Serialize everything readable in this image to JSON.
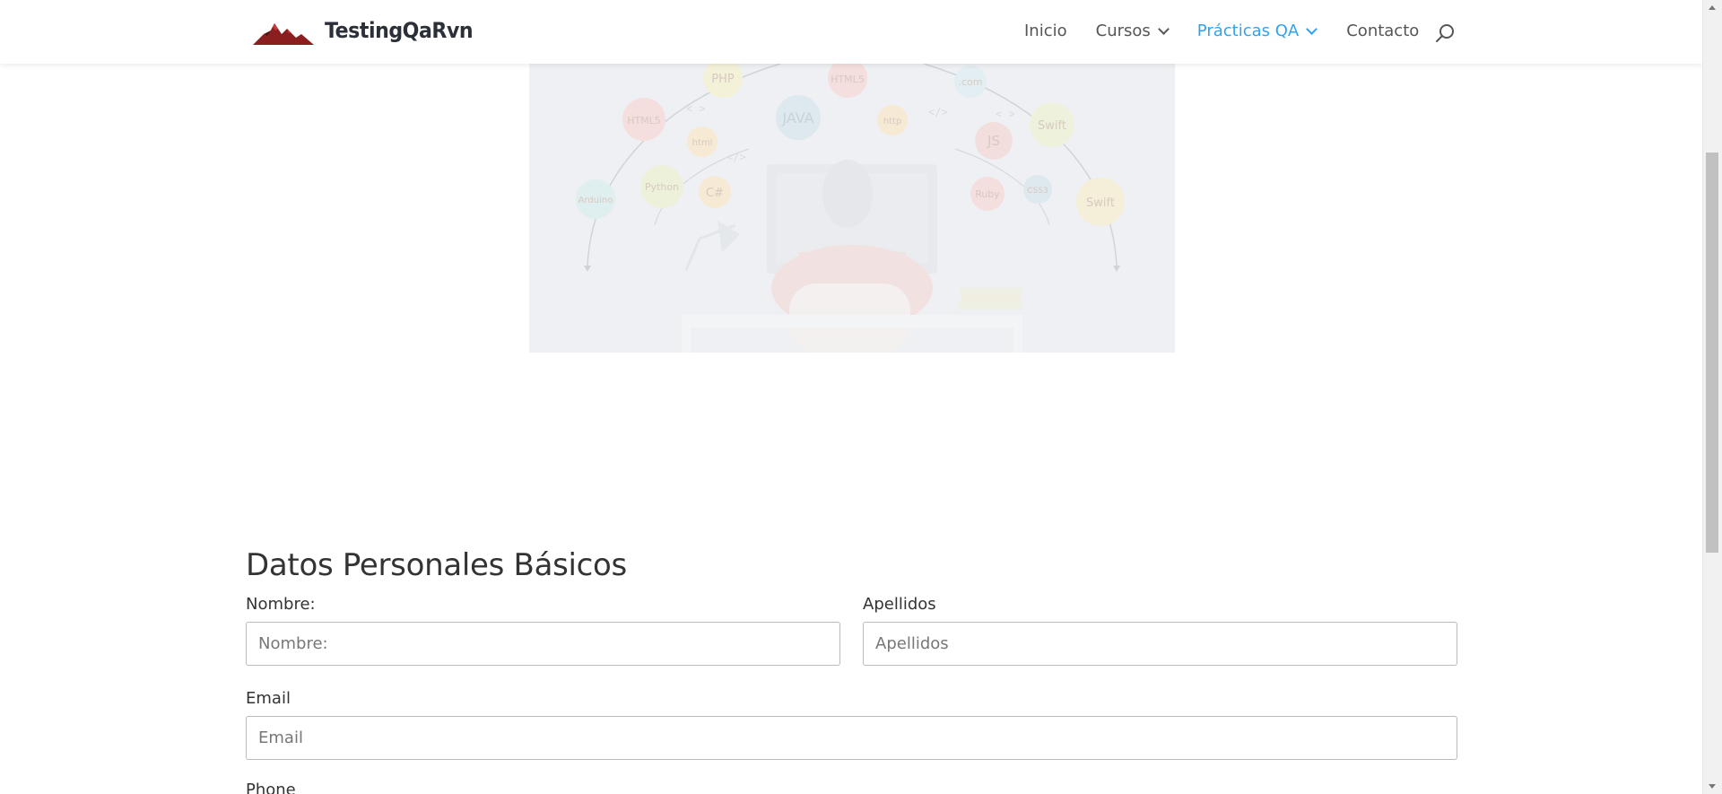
{
  "header": {
    "logo_text": "TestingQaRvn",
    "nav": [
      {
        "label": "Inicio",
        "has_dropdown": false,
        "active": false
      },
      {
        "label": "Cursos",
        "has_dropdown": true,
        "active": false
      },
      {
        "label": "Prácticas QA",
        "has_dropdown": true,
        "active": true
      },
      {
        "label": "Contacto",
        "has_dropdown": false,
        "active": false
      }
    ],
    "search_icon": "search-icon",
    "active_color": "#2ea3f2"
  },
  "hero": {
    "bubble_labels": [
      "PHP",
      "HTML5",
      ".com",
      "HTML5",
      "JAVA",
      "http",
      "Swift",
      "html",
      "JS",
      "Python",
      "C#",
      "Arduino",
      "Ruby",
      "CSS3",
      "Swift"
    ]
  },
  "form": {
    "title": "Datos Personales Básicos",
    "nombre": {
      "label": "Nombre:",
      "placeholder": "Nombre:",
      "value": ""
    },
    "apellidos": {
      "label": "Apellidos",
      "placeholder": "Apellidos",
      "value": ""
    },
    "email": {
      "label": "Email",
      "placeholder": "Email",
      "value": ""
    },
    "phone": {
      "label": "Phone"
    }
  }
}
